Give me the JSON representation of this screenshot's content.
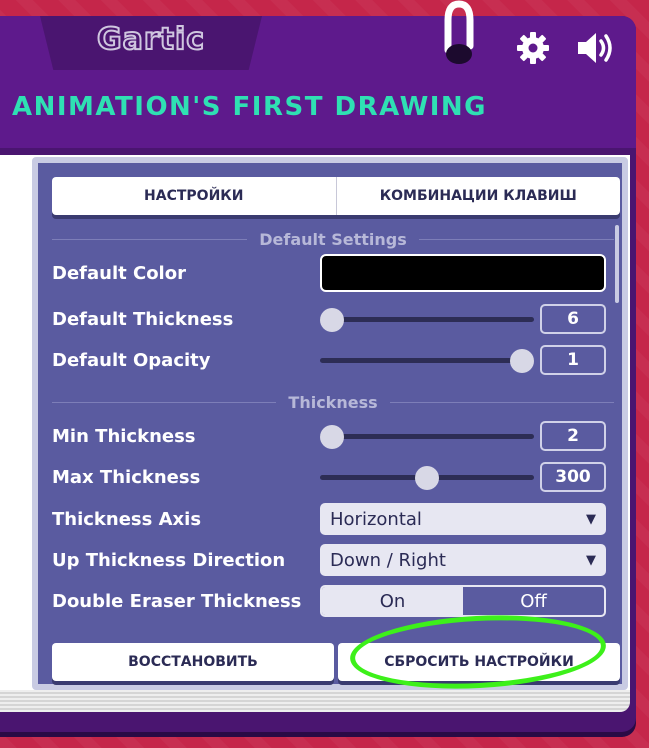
{
  "app": {
    "logo": "Gartic",
    "title": "ANIMATION'S FIRST DRAWING"
  },
  "icons": {
    "settings": "gear-icon",
    "sound": "speaker-icon"
  },
  "tabs": [
    {
      "label": "НАСТРОЙКИ"
    },
    {
      "label": "КОМБИНАЦИИ КЛАВИШ"
    }
  ],
  "sections": {
    "default": "Default Settings",
    "thickness": "Thickness"
  },
  "settings": {
    "default_color": {
      "label": "Default Color",
      "value": "#000000"
    },
    "default_thickness": {
      "label": "Default Thickness",
      "value": "6",
      "level": 0.0
    },
    "default_opacity": {
      "label": "Default Opacity",
      "value": "1",
      "level": 1.0
    },
    "min_thickness": {
      "label": "Min Thickness",
      "value": "2",
      "level": 0.0
    },
    "max_thickness": {
      "label": "Max Thickness",
      "value": "300",
      "level": 0.5
    },
    "thickness_axis": {
      "label": "Thickness Axis",
      "value": "Horizontal"
    },
    "up_direction": {
      "label": "Up Thickness Direction",
      "value": "Down / Right"
    },
    "double_eraser": {
      "label": "Double Eraser Thickness",
      "on": "On",
      "off": "Off",
      "selected": "On"
    }
  },
  "buttons": {
    "restore": "ВОССТАНОВИТЬ",
    "reset": "СБРОСИТЬ НАСТРОЙКИ"
  },
  "colors": {
    "accent": "#2fe0b3",
    "highlight": "#3df01a",
    "panel": "#5a5ba0"
  }
}
